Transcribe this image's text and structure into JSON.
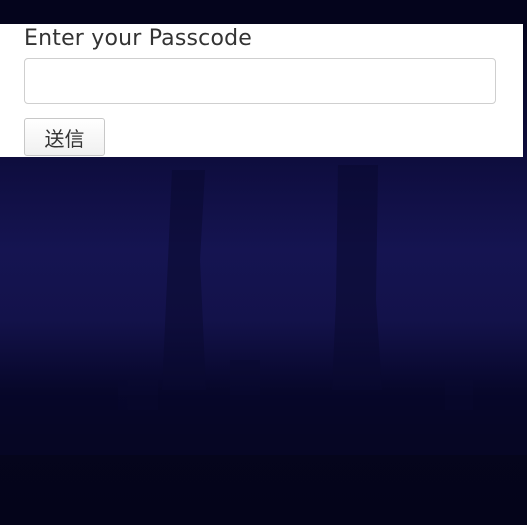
{
  "form": {
    "label": "Enter your Passcode",
    "passcode_value": "",
    "passcode_placeholder": "",
    "submit_label": "送信"
  },
  "colors": {
    "background_top": "#04041c",
    "background_mid": "#151451",
    "background_bottom": "#04041a",
    "panel": "#ffffff",
    "label_text": "#333333"
  }
}
